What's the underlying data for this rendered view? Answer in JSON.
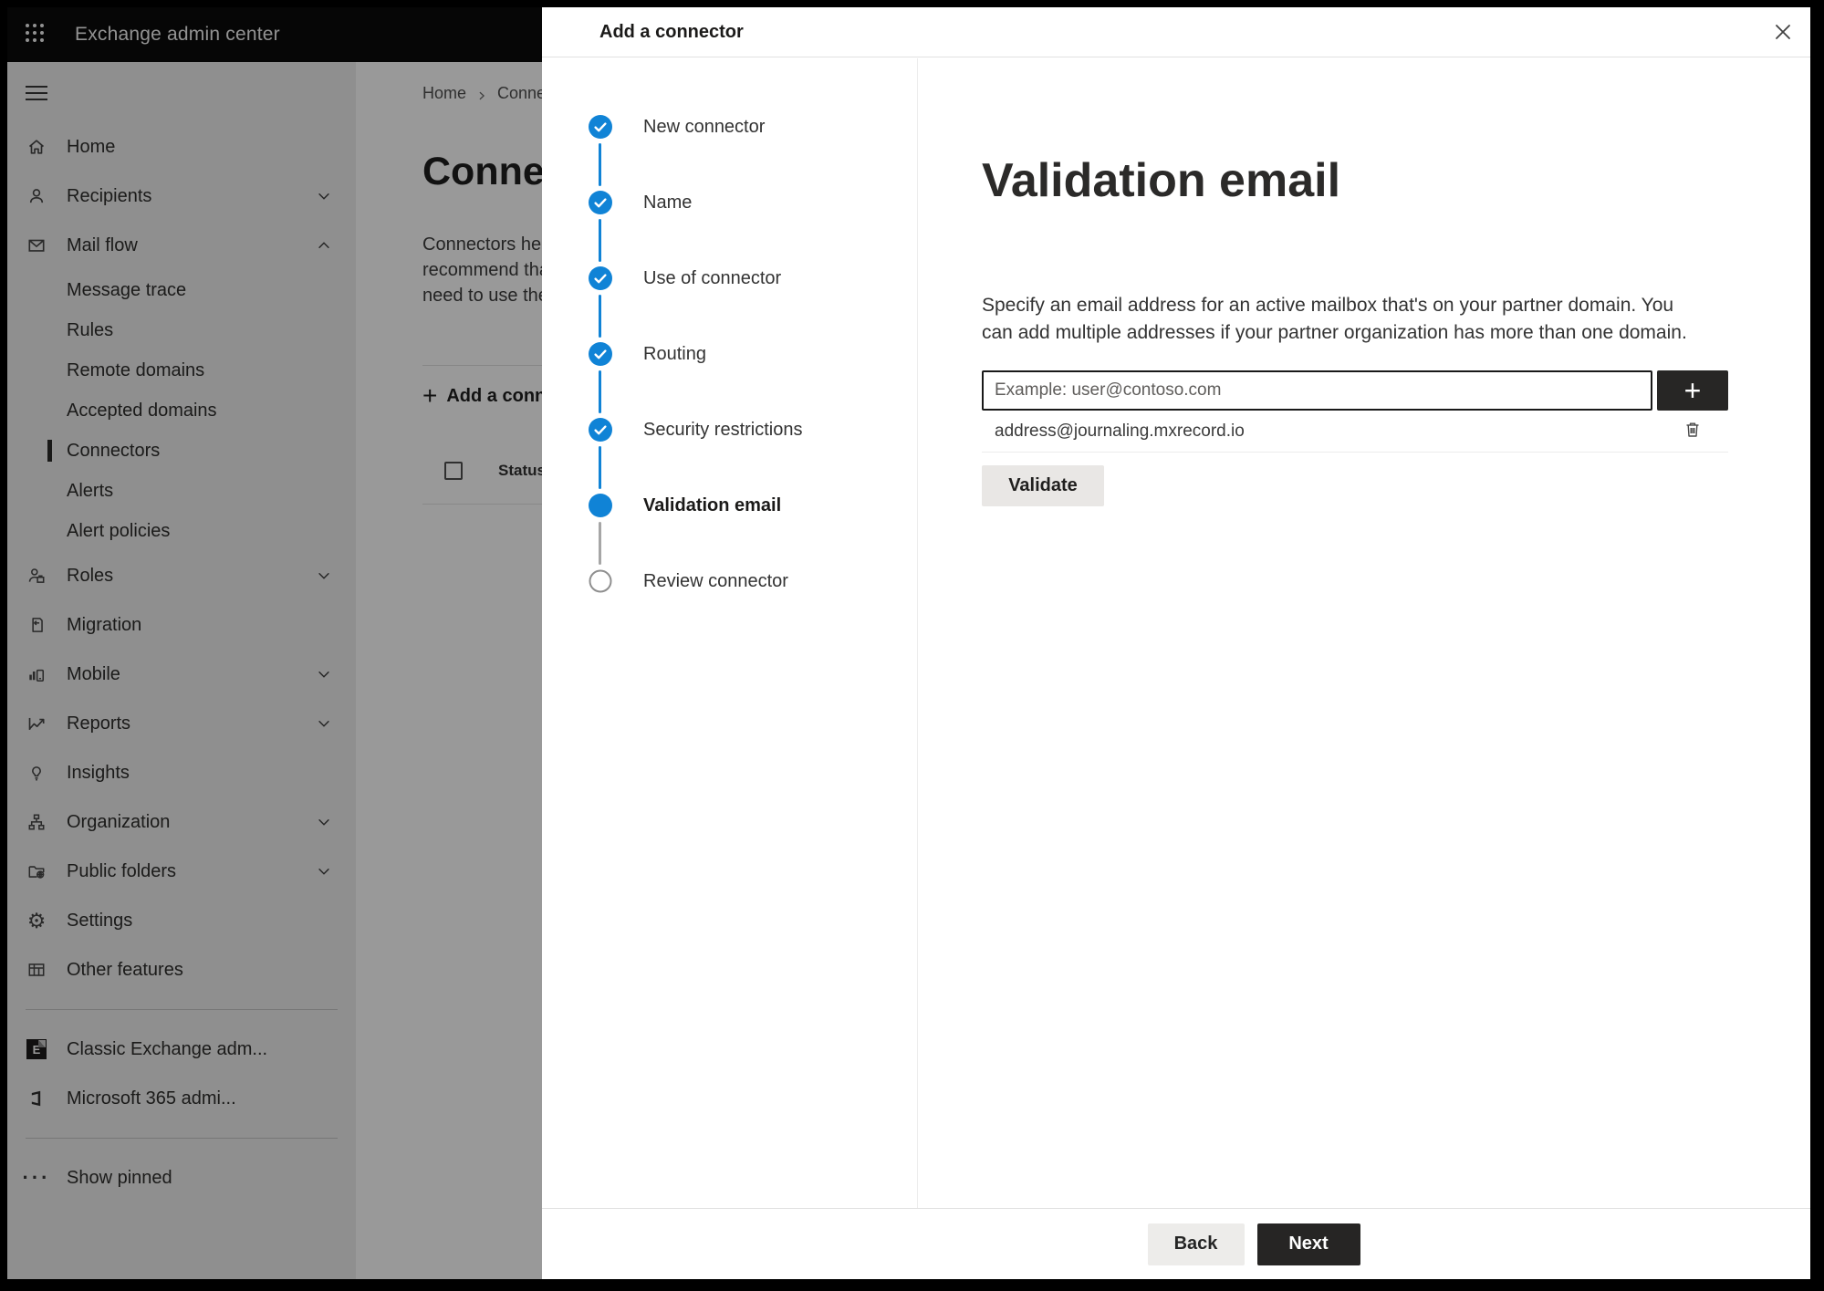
{
  "colors": {
    "accent_blue": "#1083d6",
    "topbar_bg": "#0a0a0a",
    "sidebar_bg": "#efefef",
    "panel_bg": "#ffffff",
    "dark_button_bg": "#262524",
    "light_button_bg": "#edebe9",
    "overlay": "rgba(0,0,0,0.40)"
  },
  "topbar": {
    "app_title": "Exchange admin center",
    "waffle_icon": "waffle-icon"
  },
  "sidebar": {
    "items": [
      {
        "type": "item",
        "icon": "home-icon",
        "label": "Home"
      },
      {
        "type": "item",
        "icon": "person-icon",
        "label": "Recipients",
        "chevron": "down"
      },
      {
        "type": "item",
        "icon": "mail-icon",
        "label": "Mail flow",
        "chevron": "up"
      },
      {
        "type": "sub",
        "label": "Message trace"
      },
      {
        "type": "sub",
        "label": "Rules"
      },
      {
        "type": "sub",
        "label": "Remote domains"
      },
      {
        "type": "sub",
        "label": "Accepted domains"
      },
      {
        "type": "sub",
        "label": "Connectors",
        "selected": true
      },
      {
        "type": "sub",
        "label": "Alerts"
      },
      {
        "type": "sub",
        "label": "Alert policies"
      },
      {
        "type": "item",
        "icon": "roles-icon",
        "label": "Roles",
        "chevron": "down"
      },
      {
        "type": "item",
        "icon": "migration-icon",
        "label": "Migration"
      },
      {
        "type": "item",
        "icon": "mobile-icon",
        "label": "Mobile",
        "chevron": "down"
      },
      {
        "type": "item",
        "icon": "reports-icon",
        "label": "Reports",
        "chevron": "down"
      },
      {
        "type": "item",
        "icon": "insights-icon",
        "label": "Insights"
      },
      {
        "type": "item",
        "icon": "organization-icon",
        "label": "Organization",
        "chevron": "down"
      },
      {
        "type": "item",
        "icon": "public-folders-icon",
        "label": "Public folders",
        "chevron": "down"
      },
      {
        "type": "item",
        "icon": "settings-icon",
        "label": "Settings"
      },
      {
        "type": "item",
        "icon": "other-features-icon",
        "label": "Other features"
      },
      {
        "type": "divider"
      },
      {
        "type": "item",
        "icon": "classic-exchange-icon",
        "label": "Classic Exchange adm..."
      },
      {
        "type": "item",
        "icon": "microsoft-365-icon",
        "label": "Microsoft 365 admi..."
      },
      {
        "type": "divider"
      },
      {
        "type": "item",
        "icon": "ellipsis-icon",
        "label": "Show pinned"
      }
    ]
  },
  "background_page": {
    "breadcrumb": [
      "Home",
      "Connectors"
    ],
    "page_title": "Connectors",
    "intro_lines": [
      "Connectors help",
      "recommend that",
      "need to use ther"
    ],
    "add_connector_button": "Add a connector",
    "table_columns": [
      "Status"
    ]
  },
  "panel": {
    "title": "Add a connector",
    "steps": [
      {
        "label": "New connector",
        "state": "completed"
      },
      {
        "label": "Name",
        "state": "completed"
      },
      {
        "label": "Use of connector",
        "state": "completed"
      },
      {
        "label": "Routing",
        "state": "completed"
      },
      {
        "label": "Security restrictions",
        "state": "completed"
      },
      {
        "label": "Validation email",
        "state": "current"
      },
      {
        "label": "Review connector",
        "state": "upcoming"
      }
    ],
    "content": {
      "heading": "Validation email",
      "description": "Specify an email address for an active mailbox that's on your partner domain. You can add multiple addresses if your partner organization has more than one domain.",
      "email_placeholder": "Example: user@contoso.com",
      "addresses": [
        "address@journaling.mxrecord.io"
      ],
      "validate_button": "Validate"
    },
    "footer": {
      "back_button": "Back",
      "next_button": "Next"
    }
  }
}
